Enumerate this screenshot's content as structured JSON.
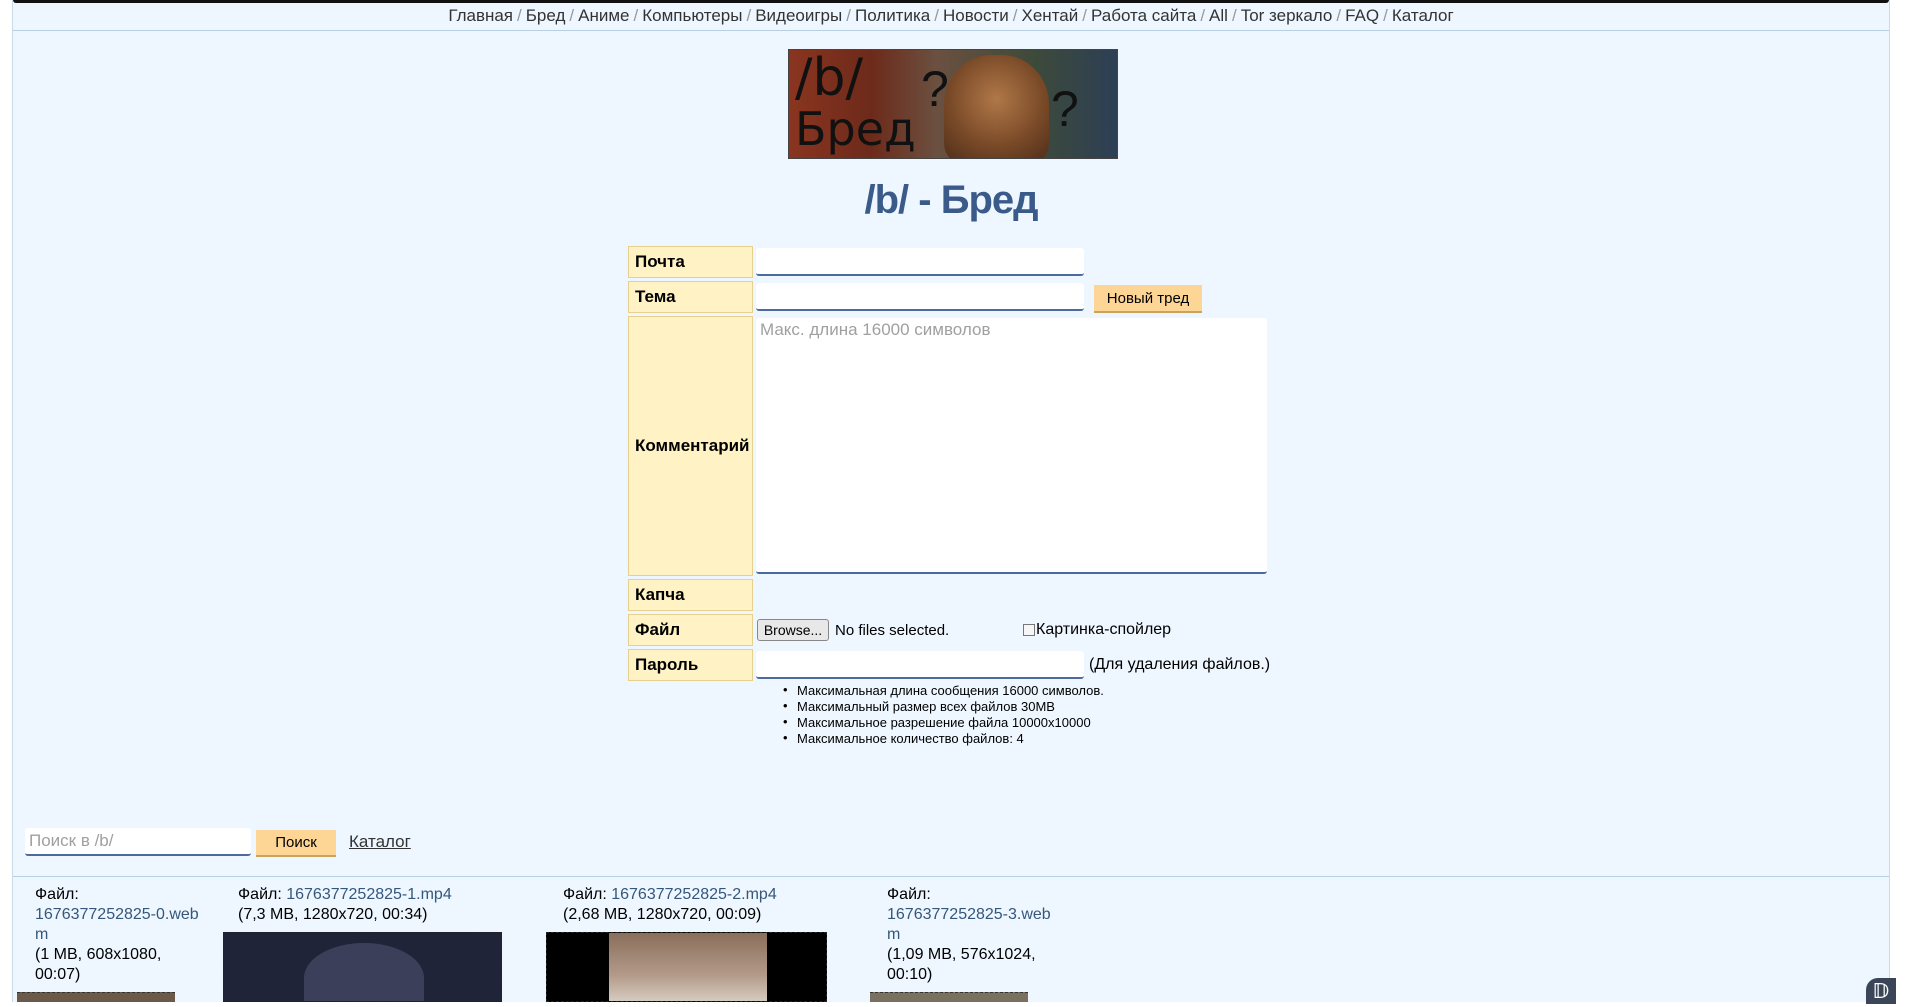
{
  "nav": {
    "items": [
      "Главная",
      "Бред",
      "Аниме",
      "Компьютеры",
      "Видеоигры",
      "Политика",
      "Новости",
      "Хентай",
      "Работа сайта",
      "All",
      "Tor зеркало",
      "FAQ",
      "Каталог"
    ],
    "separator": "/"
  },
  "banner": {
    "line1": "/b/",
    "line2": "Бред",
    "mark": "?"
  },
  "board_title": "/b/ - Бред",
  "form": {
    "email_label": "Почта",
    "subject_label": "Тема",
    "comment_label": "Комментарий",
    "comment_placeholder": "Макс. длина 16000 символов",
    "captcha_label": "Капча",
    "file_label": "Файл",
    "password_label": "Пароль",
    "new_thread_button": "Новый тред",
    "browse_button": "Browse...",
    "no_files_text": "No files selected.",
    "spoiler_label": "Картинка-спойлер",
    "password_hint": "(Для удаления файлов.)",
    "rules": [
      "Максимальная длина сообщения 16000 символов.",
      "Максимальный размер всех файлов 30MB",
      "Максимальное разрешение файла 10000x10000",
      "Максимальное количество файлов: 4"
    ]
  },
  "search": {
    "placeholder": "Поиск в /b/",
    "button": "Поиск",
    "catalog_link": "Каталог"
  },
  "files": [
    {
      "prefix": "Файл:",
      "name_line1": "1676377252825-0.web",
      "name_line2": "m",
      "info_line1": "(1 MB, 608x1080,",
      "info_line2": "00:07)"
    },
    {
      "prefix": "Файл:",
      "name": "1676377252825-1.mp4",
      "info": "(7,3 MB, 1280x720, 00:34)"
    },
    {
      "prefix": "Файл:",
      "name": "1676377252825-2.mp4",
      "info": "(2,68 MB, 1280x720, 00:09)"
    },
    {
      "prefix": "Файл:",
      "name_line1": "1676377252825-3.web",
      "name_line2": "m",
      "info_line1": "(1,09 MB, 576x1024,",
      "info_line2": "00:10)"
    }
  ],
  "corner_icon": "dc-icon",
  "colors": {
    "background": "#eef7ff",
    "label_bg": "#fff2c4",
    "button_bg": "#fdd594",
    "title": "#3a5a8a",
    "link": "#34577a"
  }
}
